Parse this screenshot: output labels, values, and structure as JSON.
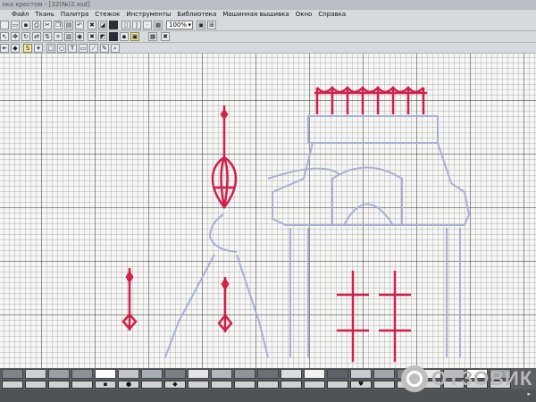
{
  "window": {
    "title": "лка крестом - [32(№)2.xsd]"
  },
  "menu": {
    "items": [
      "Файл",
      "Ткань",
      "Палитра",
      "Стежок",
      "Инструменты",
      "Библиотека",
      "Машинная вышивка",
      "Окно",
      "Справка"
    ]
  },
  "toolbar": {
    "zoom_value": "100%",
    "text_tool_label": "T",
    "select_tool_label": "S"
  },
  "palette": {
    "swatch_colors": [
      "#7f848b",
      "#cdd0d4",
      "#9aa0a6",
      "#8c9198",
      "#ffffff",
      "#c2c6cb",
      "#a9aeb4",
      "#7b8087",
      "#e3e5e8",
      "#b3b8be",
      "#8f949b",
      "#6c7178",
      "#d9dce0",
      "#f1f1f1",
      "#5e6369",
      "#c8ccd1",
      "#a1a6ad",
      "#7e838a",
      "#e7e9ec",
      "#b8bcc2",
      "#ffffff",
      "#9ca1a8"
    ],
    "swatch_symbols": [
      "",
      "",
      "",
      "",
      "▪",
      "●",
      "",
      "◆",
      "",
      "",
      "",
      "",
      "",
      "",
      "",
      "♥",
      "",
      "",
      "",
      "",
      "",
      ""
    ]
  },
  "watermark": {
    "text": "ОТЗОВИК"
  },
  "colors": {
    "stitch_red": "#d21e4a",
    "outline_blue": "#a9b0d2"
  }
}
